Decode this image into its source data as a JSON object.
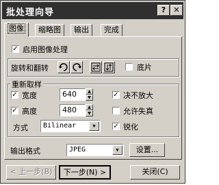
{
  "window": {
    "title": "批处理向导"
  },
  "title_buttons": {
    "help": "?",
    "close": "✕"
  },
  "tabs": [
    {
      "label": "图像",
      "active": true
    },
    {
      "label": "缩略图",
      "active": false
    },
    {
      "label": "输出",
      "active": false
    },
    {
      "label": "完成",
      "active": false
    }
  ],
  "enable_processing": {
    "label": "启用图像处理",
    "checked": true
  },
  "rotate": {
    "label": "旋转和翻转",
    "icons": [
      "rotate-left-icon",
      "rotate-right-icon",
      "flip-horizontal-icon",
      "flip-vertical-icon"
    ]
  },
  "negative": {
    "label": "底片",
    "checked": false
  },
  "resample": {
    "group_label": "重新取样",
    "width": {
      "label": "宽度",
      "checked": true,
      "value": "640"
    },
    "height": {
      "label": "高度",
      "checked": true,
      "value": "480"
    },
    "no_enlarge": {
      "label": "决不放大",
      "checked": true
    },
    "allow_distortion": {
      "label": "允许失真",
      "checked": false
    },
    "method": {
      "label": "方式",
      "value": "Bilinear"
    },
    "sharpen": {
      "label": "锐化",
      "checked": true
    }
  },
  "output_format": {
    "label": "输出格式",
    "value": "JPEG",
    "settings_label": "设置..."
  },
  "footer": {
    "back_label": "< 上一步(B)",
    "next_label": "下一步(N) >",
    "close_label": "关闭(C)"
  },
  "glyphs": {
    "check": "✓",
    "up": "▲",
    "down": "▼"
  }
}
